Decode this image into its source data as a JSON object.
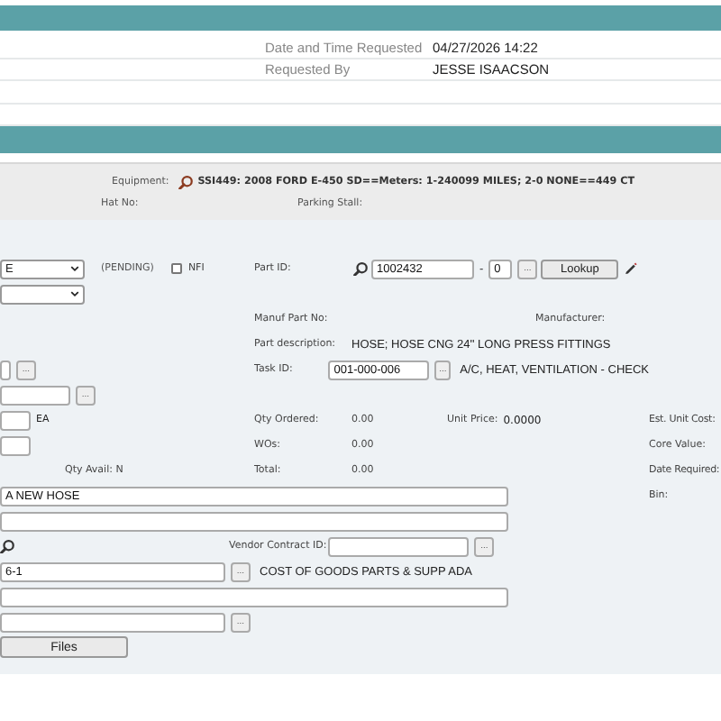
{
  "header": {
    "fields": [
      {
        "label": "Date and Time Requested",
        "value": "04/27/2026 14:22"
      },
      {
        "label": "Requested By",
        "value": "JESSE ISAACSON"
      }
    ]
  },
  "equipment": {
    "label": "Equipment:",
    "value": "SSI449: 2008 FORD E-450 SD==Meters: 1-240099 MILES; 2-0 NONE==449 CT",
    "hat_no_label": "Hat No:",
    "parking_stall_label": "Parking Stall:"
  },
  "form": {
    "status_select": {
      "value": "E"
    },
    "status": "(PENDING)",
    "nfi": {
      "label": "NFI",
      "checked": false
    },
    "part_id": {
      "label": "Part ID:",
      "value": "1002432",
      "dash": "-",
      "suffix": "0",
      "button": "...",
      "lookup_button": "Lookup"
    },
    "manuf_part_no_label": "Manuf Part No:",
    "manufacturer_label": "Manufacturer:",
    "part_description": {
      "label": "Part description:",
      "value": "HOSE; HOSE CNG 24'' LONG PRESS FITTINGS"
    },
    "left_field_1": {
      "button": "..."
    },
    "left_field_2": {
      "button": "..."
    },
    "task_id": {
      "label": "Task ID:",
      "value": "001-000-006",
      "button": "...",
      "description": "A/C, HEAT, VENTILATION - CHECK"
    },
    "unit": "EA",
    "qty_ordered": {
      "label": "Qty Ordered:",
      "value": "0.00"
    },
    "unit_price": {
      "label": "Unit Price:",
      "value": "0.0000"
    },
    "est_unit_cost_label": "Est. Unit Cost:",
    "wos": {
      "label": "WOs:",
      "value": "0.00"
    },
    "core_value_label": "Core Value:",
    "qty_avail": "Qty Avail: N",
    "total": {
      "label": "Total:",
      "value": "0.00"
    },
    "date_required_label": "Date Required:",
    "comment_field": {
      "value": "A NEW HOSE"
    },
    "bin_label": "Bin:",
    "vendor_contract_id": {
      "label": "Vendor Contract ID:",
      "button": "..."
    },
    "account": {
      "value": "6-1",
      "button": "...",
      "description": "COST OF GOODS PARTS & SUPP ADA"
    },
    "left_field_3": {
      "button": "..."
    },
    "files_button": "Files"
  }
}
